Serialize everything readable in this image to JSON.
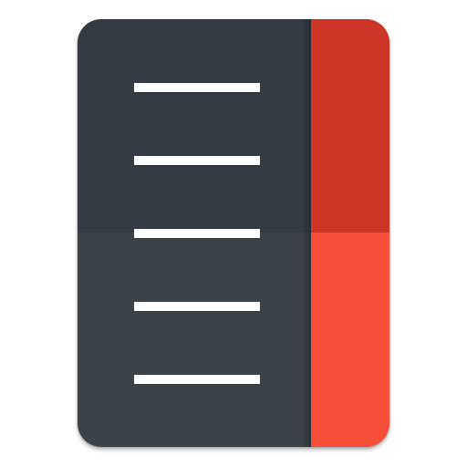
{
  "icon": {
    "name": "settings-list-app-icon",
    "colors": {
      "panel_top": "#343b43",
      "panel_bottom": "#3b4349",
      "strip_top": "#cd3527",
      "strip_bottom": "#f64f3a",
      "lines": "#ffffff"
    },
    "line_count": 5
  }
}
